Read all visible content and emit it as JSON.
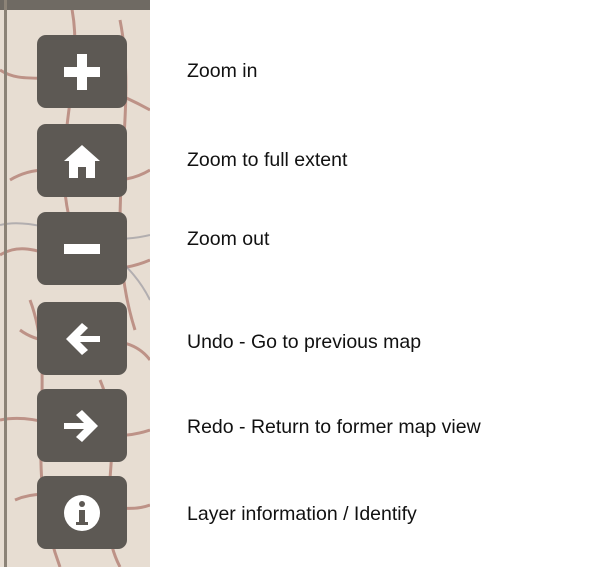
{
  "toolbar": {
    "buttons": [
      {
        "icon": "zoom-in-plus-icon",
        "label": "Zoom in"
      },
      {
        "icon": "home-icon",
        "label": "Zoom to full extent"
      },
      {
        "icon": "zoom-out-minus-icon",
        "label": "Zoom out"
      },
      {
        "icon": "arrow-left-icon",
        "label": "Undo - Go to previous map"
      },
      {
        "icon": "arrow-right-icon",
        "label": "Redo - Return to former map view"
      },
      {
        "icon": "info-icon",
        "label": "Layer information / Identify"
      }
    ]
  },
  "colors": {
    "button_bg": "#5d5954",
    "icon": "#ffffff",
    "map_bg": "#e7ddd2",
    "map_roads": "#b07a6f",
    "label_text": "#111111"
  }
}
